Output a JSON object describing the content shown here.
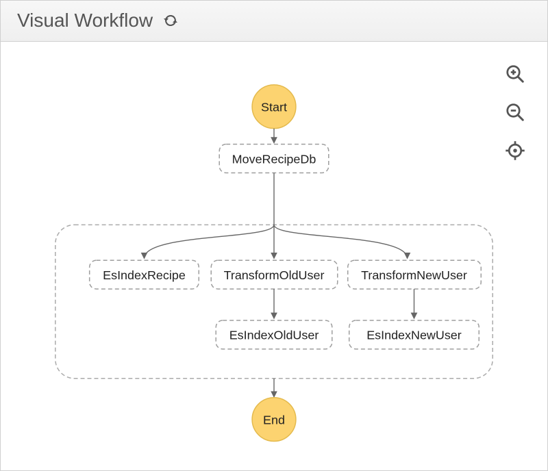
{
  "header": {
    "title": "Visual Workflow",
    "refresh_icon": "refresh"
  },
  "controls": {
    "zoom_in": "zoom-in",
    "zoom_out": "zoom-out",
    "center": "center-target"
  },
  "diagram": {
    "start": {
      "label": "Start"
    },
    "end": {
      "label": "End"
    },
    "nodes": {
      "moveRecipeDb": "MoveRecipeDb",
      "esIndexRecipe": "EsIndexRecipe",
      "transformOldUser": "TransformOldUser",
      "esIndexOldUser": "EsIndexOldUser",
      "transformNewUser": "TransformNewUser",
      "esIndexNewUser": "EsIndexNewUser"
    }
  }
}
